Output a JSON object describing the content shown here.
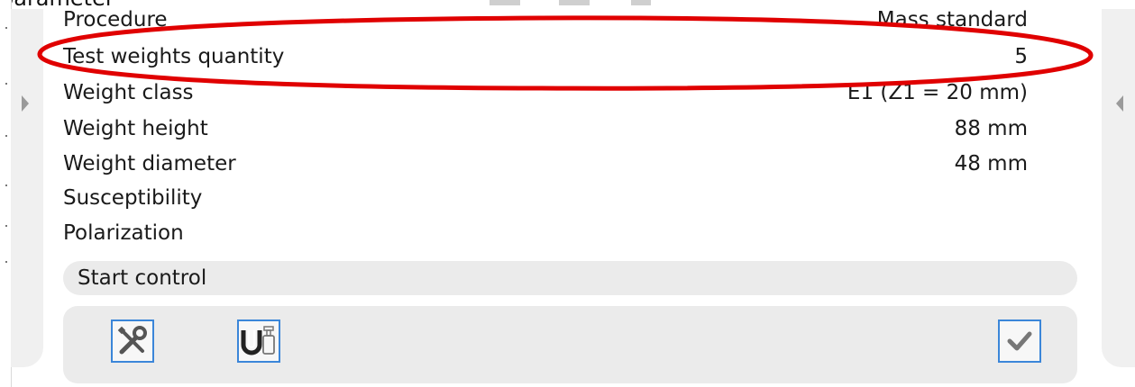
{
  "header": {
    "clipped_text": "parameter"
  },
  "parameters": [
    {
      "label": "Procedure",
      "value": "Mass standard"
    },
    {
      "label": "Test weights quantity",
      "value": "5"
    },
    {
      "label": "Weight class",
      "value": "E1 (Z1 = 20 mm)"
    },
    {
      "label": "Weight height",
      "value": "88 mm"
    },
    {
      "label": "Weight diameter",
      "value": "48 mm"
    },
    {
      "label": "Susceptibility",
      "value": ""
    },
    {
      "label": "Polarization",
      "value": ""
    }
  ],
  "start_control": {
    "label": "Start control"
  },
  "toolbar": {
    "icons": [
      "tools-icon",
      "magnet-weight-icon",
      "checkmark-icon"
    ]
  },
  "highlight": {
    "target": "Test weights quantity",
    "color": "#e00000"
  },
  "colors": {
    "button_border": "#3b86d9",
    "panel_bg": "#ebebeb",
    "side_bg": "#f0f0f0"
  }
}
